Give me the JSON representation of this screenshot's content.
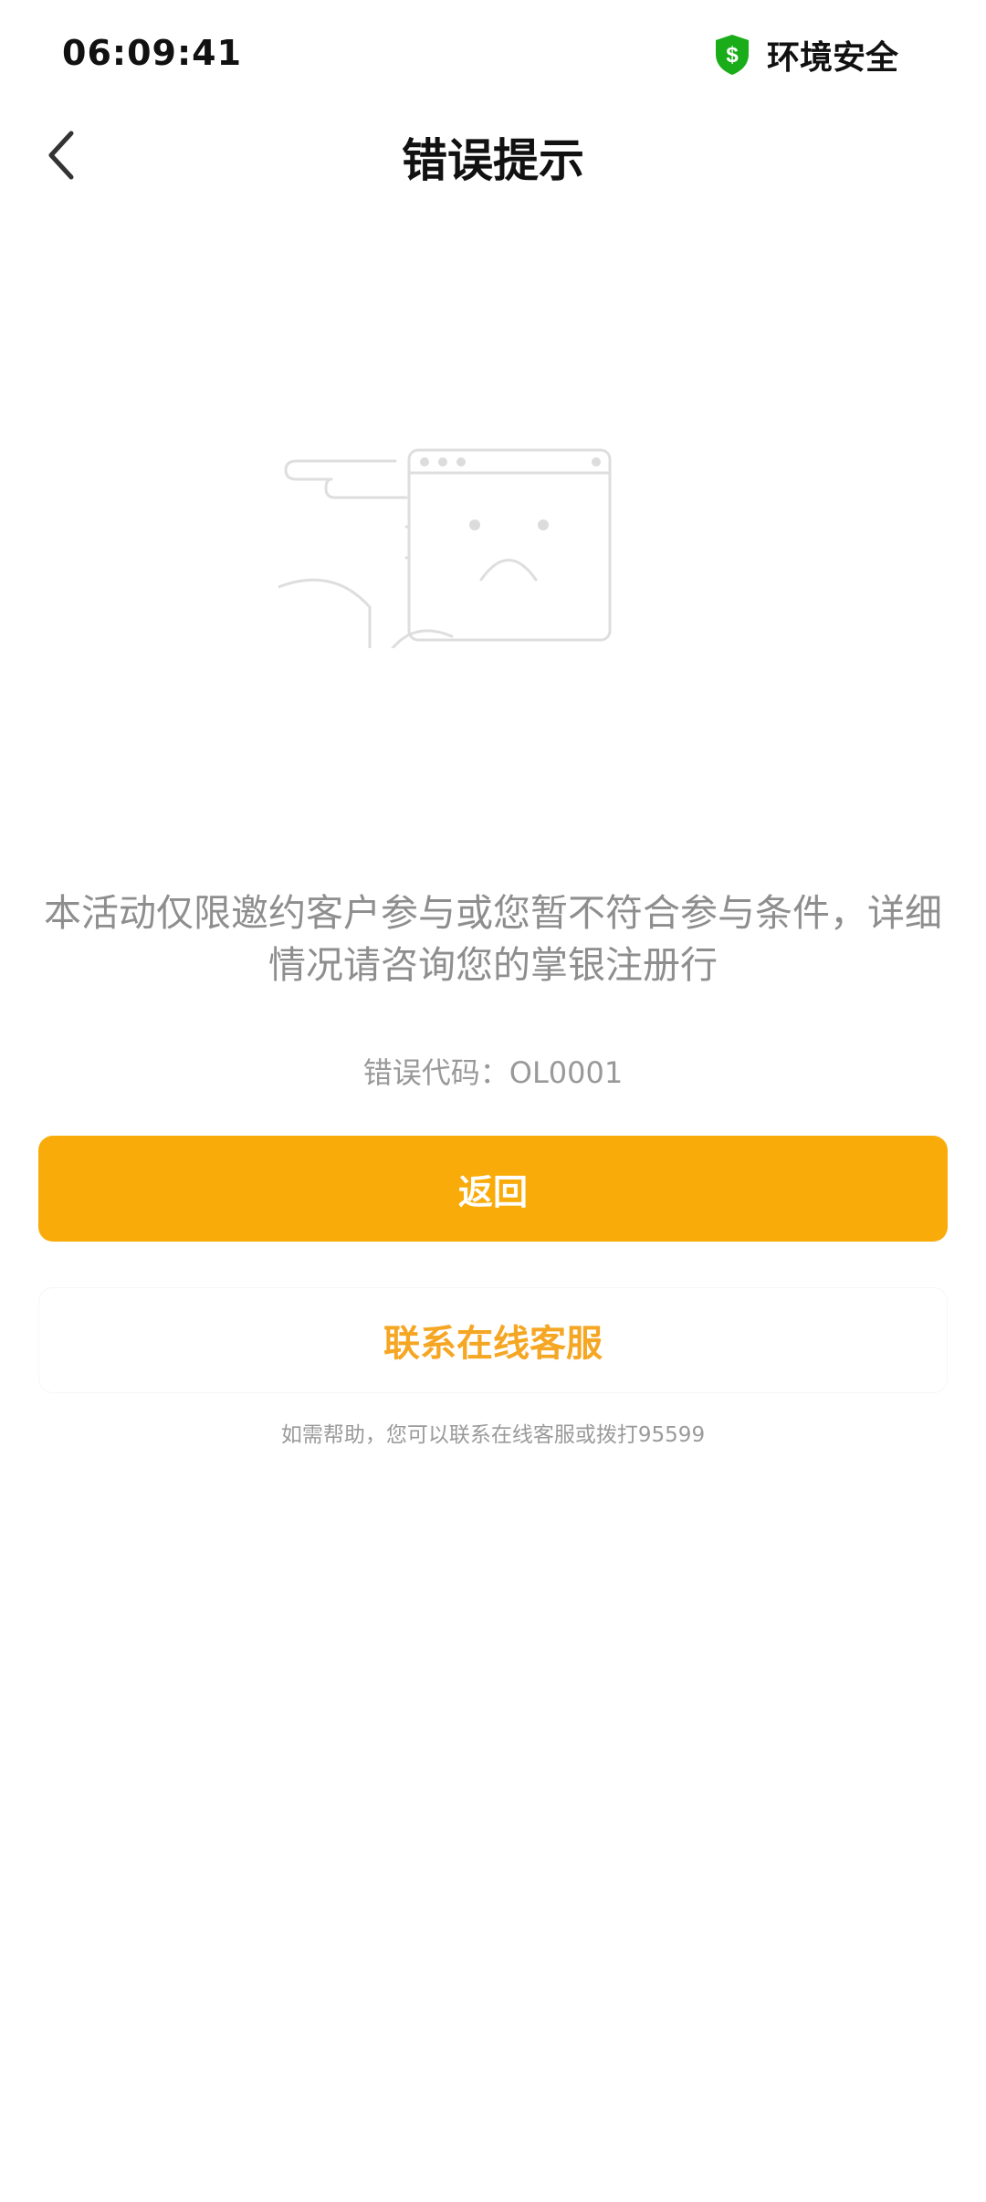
{
  "status_bar": {
    "time": "06:09:41",
    "security_label": "环境安全",
    "shield_color": "#1aad19",
    "shield_symbol": "$"
  },
  "nav": {
    "title": "错误提示",
    "back_icon": "chevron-left-icon"
  },
  "illustration": {
    "icon": "sad-browser-window-illustration"
  },
  "error": {
    "message": "本活动仅限邀约客户参与或您暂不符合参与条件，详细情况请咨询您的掌银注册行",
    "code_text": "错误代码：OL0001"
  },
  "actions": {
    "return_label": "返回",
    "service_label": "联系在线客服"
  },
  "help": {
    "text": "如需帮助，您可以联系在线客服或拨打95599"
  },
  "colors": {
    "accent": "#f9ab0a",
    "secondary_text": "#f5a623"
  }
}
